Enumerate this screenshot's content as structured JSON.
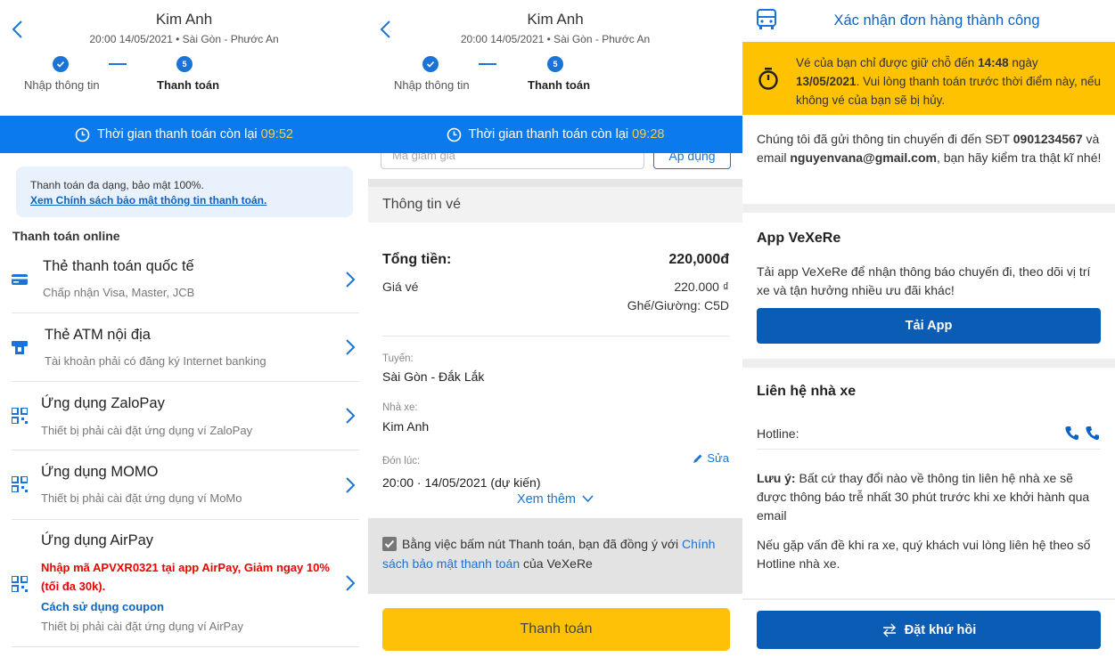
{
  "p1": {
    "header": {
      "title": "Kim Anh",
      "subtitle": "20:00 14/05/2021 • Sài Gòn - Phước An"
    },
    "steps": [
      {
        "label": "Nhập thông tin",
        "done": true
      },
      {
        "label": "Thanh toán",
        "number": "5"
      }
    ],
    "timer": {
      "text": "Thời gian thanh toán còn lại",
      "value": "09:52"
    },
    "notice": {
      "text": "Thanh toán đa dạng, bảo mật 100%.",
      "link": "Xem Chính sách bảo mật thông tin thanh toán."
    },
    "section_title": "Thanh toán online",
    "methods": [
      {
        "name": "Thẻ thanh toán quốc tế",
        "desc": "Chấp nhận Visa, Master, JCB",
        "icon": "credit-card-icon"
      },
      {
        "name": "Thẻ ATM nội địa",
        "desc": "Tài khoản phải có đăng ký Internet banking",
        "icon": "atm-icon"
      },
      {
        "name": "Ứng dụng ZaloPay",
        "desc": "Thiết bị phải cài đặt ứng dụng ví ZaloPay",
        "icon": "qr-icon"
      },
      {
        "name": "Ứng dụng MOMO",
        "desc": "Thiết bị phải cài đặt ứng dụng ví MoMo",
        "icon": "qr-icon"
      },
      {
        "name": "Ứng dụng AirPay",
        "promo": "Nhập mã APVXR0321 tại app AirPay, Giảm ngay 10% (tối đa 30k).",
        "howto": "Cách sử dụng coupon",
        "desc": "Thiết bị phải cài đặt ứng dụng ví AirPay",
        "icon": "qr-icon"
      }
    ]
  },
  "p2": {
    "header": {
      "title": "Kim Anh",
      "subtitle": "20:00 14/05/2021 • Sài Gòn - Phước An"
    },
    "steps": [
      {
        "label": "Nhập thông tin"
      },
      {
        "label": "Thanh toán",
        "number": "5"
      }
    ],
    "timer": {
      "text": "Thời gian thanh toán còn lại",
      "value": "09:28"
    },
    "coupon": {
      "placeholder": "Mã giảm giá",
      "apply": "Áp dụng"
    },
    "ticket_head": "Thông tin vé",
    "total_label": "Tổng tiền:",
    "total_value": "220,000đ",
    "price_label": "Giá vé",
    "price_value": "220.000 ₫",
    "seat": "Ghế/Giường: C5D",
    "route_label": "Tuyến:",
    "route_value": "Sài Gòn - Đắk Lắk",
    "operator_label": "Nhà xe:",
    "operator_value": "Kim Anh",
    "pickup_label": "Đón lúc:",
    "edit": "Sửa",
    "pickup_value": "20:00 · 14/05/2021 (dự kiến)",
    "more": "Xem thêm",
    "agree_text": "Bằng việc bấm nút Thanh toán, bạn đã đồng ý với",
    "agree_link": "Chính sách bảo mật thanh toán",
    "agree_tail": "của VeXeRe",
    "pay_button": "Thanh toán"
  },
  "p3": {
    "title": "Xác nhận đơn hàng thành công",
    "warn_pre": "Vé của bạn chỉ được giữ chỗ đến",
    "warn_time": "14:48",
    "warn_mid": "ngày",
    "warn_date": "13/05/2021",
    "warn_post": ". Vui lòng thanh toán trước thời điểm này, nếu không vé của bạn sẽ bị hủy.",
    "sent_pre": "Chúng tôi đã gửi thông tin chuyến đi đến SĐT",
    "phone": "0901234567",
    "sent_mid": "và email",
    "email": "nguyenvana@gmail.com",
    "sent_post": ", bạn hãy kiểm tra thật kĩ nhé!",
    "app_title": "App VeXeRe",
    "app_text": "Tải app VeXeRe để nhận thông báo chuyến đi, theo dõi vị trí xe và tận hưởng nhiều ưu đãi khác!",
    "app_button": "Tải App",
    "contact_title": "Liên hệ nhà xe",
    "hotline_label": "Hotline:",
    "note_label": "Lưu ý:",
    "note_text": "Bất cứ thay đổi nào về thông tin liên hệ nhà xe sẽ được thông báo trễ nhất 30 phút trước khi xe khởi hành qua email",
    "issue_text": "Nếu gặp vấn đề khi ra xe, quý khách vui lòng liên hệ theo số Hotline nhà xe.",
    "return_button": "Đặt khứ hồi"
  },
  "colors": {
    "primary": "#0a7aec",
    "accent": "#ffc107",
    "warning": "#ffc200",
    "dark_blue": "#0b5cb5",
    "promo_red": "#e00000"
  }
}
